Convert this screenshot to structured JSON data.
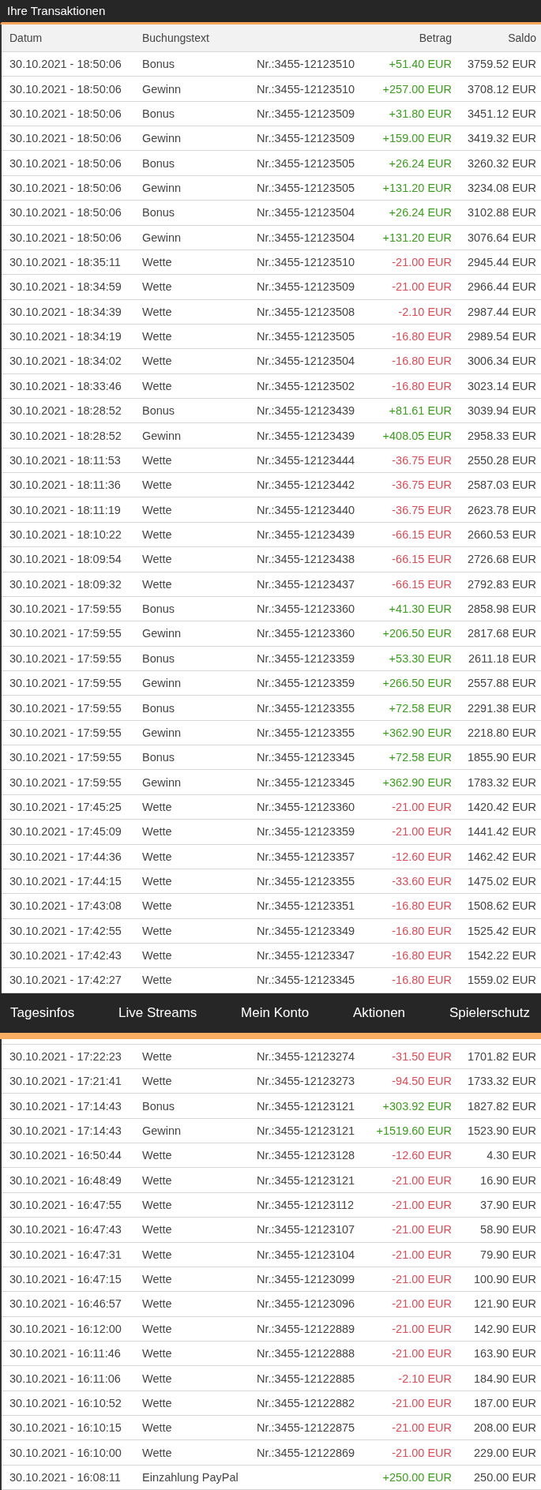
{
  "title": "Ihre Transaktionen",
  "columns": [
    "Datum",
    "Buchungstext",
    "Betrag",
    "Saldo"
  ],
  "transactions": [
    {
      "date": "30.10.2021 - 18:50:06",
      "text": "Bonus",
      "reference": "Nr.:3455-12123510",
      "amount": "+51.40 EUR",
      "balance": "3759.52 EUR",
      "kind": "credit"
    },
    {
      "date": "30.10.2021 - 18:50:06",
      "text": "Gewinn",
      "reference": "Nr.:3455-12123510",
      "amount": "+257.00 EUR",
      "balance": "3708.12 EUR",
      "kind": "credit"
    },
    {
      "date": "30.10.2021 - 18:50:06",
      "text": "Bonus",
      "reference": "Nr.:3455-12123509",
      "amount": "+31.80 EUR",
      "balance": "3451.12 EUR",
      "kind": "credit"
    },
    {
      "date": "30.10.2021 - 18:50:06",
      "text": "Gewinn",
      "reference": "Nr.:3455-12123509",
      "amount": "+159.00 EUR",
      "balance": "3419.32 EUR",
      "kind": "credit"
    },
    {
      "date": "30.10.2021 - 18:50:06",
      "text": "Bonus",
      "reference": "Nr.:3455-12123505",
      "amount": "+26.24 EUR",
      "balance": "3260.32 EUR",
      "kind": "credit"
    },
    {
      "date": "30.10.2021 - 18:50:06",
      "text": "Gewinn",
      "reference": "Nr.:3455-12123505",
      "amount": "+131.20 EUR",
      "balance": "3234.08 EUR",
      "kind": "credit"
    },
    {
      "date": "30.10.2021 - 18:50:06",
      "text": "Bonus",
      "reference": "Nr.:3455-12123504",
      "amount": "+26.24 EUR",
      "balance": "3102.88 EUR",
      "kind": "credit"
    },
    {
      "date": "30.10.2021 - 18:50:06",
      "text": "Gewinn",
      "reference": "Nr.:3455-12123504",
      "amount": "+131.20 EUR",
      "balance": "3076.64 EUR",
      "kind": "credit"
    },
    {
      "date": "30.10.2021 - 18:35:11",
      "text": "Wette",
      "reference": "Nr.:3455-12123510",
      "amount": "-21.00 EUR",
      "balance": "2945.44 EUR",
      "kind": "debit"
    },
    {
      "date": "30.10.2021 - 18:34:59",
      "text": "Wette",
      "reference": "Nr.:3455-12123509",
      "amount": "-21.00 EUR",
      "balance": "2966.44 EUR",
      "kind": "debit"
    },
    {
      "date": "30.10.2021 - 18:34:39",
      "text": "Wette",
      "reference": "Nr.:3455-12123508",
      "amount": "-2.10 EUR",
      "balance": "2987.44 EUR",
      "kind": "debit"
    },
    {
      "date": "30.10.2021 - 18:34:19",
      "text": "Wette",
      "reference": "Nr.:3455-12123505",
      "amount": "-16.80 EUR",
      "balance": "2989.54 EUR",
      "kind": "debit"
    },
    {
      "date": "30.10.2021 - 18:34:02",
      "text": "Wette",
      "reference": "Nr.:3455-12123504",
      "amount": "-16.80 EUR",
      "balance": "3006.34 EUR",
      "kind": "debit"
    },
    {
      "date": "30.10.2021 - 18:33:46",
      "text": "Wette",
      "reference": "Nr.:3455-12123502",
      "amount": "-16.80 EUR",
      "balance": "3023.14 EUR",
      "kind": "debit"
    },
    {
      "date": "30.10.2021 - 18:28:52",
      "text": "Bonus",
      "reference": "Nr.:3455-12123439",
      "amount": "+81.61 EUR",
      "balance": "3039.94 EUR",
      "kind": "credit"
    },
    {
      "date": "30.10.2021 - 18:28:52",
      "text": "Gewinn",
      "reference": "Nr.:3455-12123439",
      "amount": "+408.05 EUR",
      "balance": "2958.33 EUR",
      "kind": "credit"
    },
    {
      "date": "30.10.2021 - 18:11:53",
      "text": "Wette",
      "reference": "Nr.:3455-12123444",
      "amount": "-36.75 EUR",
      "balance": "2550.28 EUR",
      "kind": "debit"
    },
    {
      "date": "30.10.2021 - 18:11:36",
      "text": "Wette",
      "reference": "Nr.:3455-12123442",
      "amount": "-36.75 EUR",
      "balance": "2587.03 EUR",
      "kind": "debit"
    },
    {
      "date": "30.10.2021 - 18:11:19",
      "text": "Wette",
      "reference": "Nr.:3455-12123440",
      "amount": "-36.75 EUR",
      "balance": "2623.78 EUR",
      "kind": "debit"
    },
    {
      "date": "30.10.2021 - 18:10:22",
      "text": "Wette",
      "reference": "Nr.:3455-12123439",
      "amount": "-66.15 EUR",
      "balance": "2660.53 EUR",
      "kind": "debit"
    },
    {
      "date": "30.10.2021 - 18:09:54",
      "text": "Wette",
      "reference": "Nr.:3455-12123438",
      "amount": "-66.15 EUR",
      "balance": "2726.68 EUR",
      "kind": "debit"
    },
    {
      "date": "30.10.2021 - 18:09:32",
      "text": "Wette",
      "reference": "Nr.:3455-12123437",
      "amount": "-66.15 EUR",
      "balance": "2792.83 EUR",
      "kind": "debit"
    },
    {
      "date": "30.10.2021 - 17:59:55",
      "text": "Bonus",
      "reference": "Nr.:3455-12123360",
      "amount": "+41.30 EUR",
      "balance": "2858.98 EUR",
      "kind": "credit"
    },
    {
      "date": "30.10.2021 - 17:59:55",
      "text": "Gewinn",
      "reference": "Nr.:3455-12123360",
      "amount": "+206.50 EUR",
      "balance": "2817.68 EUR",
      "kind": "credit"
    },
    {
      "date": "30.10.2021 - 17:59:55",
      "text": "Bonus",
      "reference": "Nr.:3455-12123359",
      "amount": "+53.30 EUR",
      "balance": "2611.18 EUR",
      "kind": "credit"
    },
    {
      "date": "30.10.2021 - 17:59:55",
      "text": "Gewinn",
      "reference": "Nr.:3455-12123359",
      "amount": "+266.50 EUR",
      "balance": "2557.88 EUR",
      "kind": "credit"
    },
    {
      "date": "30.10.2021 - 17:59:55",
      "text": "Bonus",
      "reference": "Nr.:3455-12123355",
      "amount": "+72.58 EUR",
      "balance": "2291.38 EUR",
      "kind": "credit"
    },
    {
      "date": "30.10.2021 - 17:59:55",
      "text": "Gewinn",
      "reference": "Nr.:3455-12123355",
      "amount": "+362.90 EUR",
      "balance": "2218.80 EUR",
      "kind": "credit"
    },
    {
      "date": "30.10.2021 - 17:59:55",
      "text": "Bonus",
      "reference": "Nr.:3455-12123345",
      "amount": "+72.58 EUR",
      "balance": "1855.90 EUR",
      "kind": "credit"
    },
    {
      "date": "30.10.2021 - 17:59:55",
      "text": "Gewinn",
      "reference": "Nr.:3455-12123345",
      "amount": "+362.90 EUR",
      "balance": "1783.32 EUR",
      "kind": "credit"
    },
    {
      "date": "30.10.2021 - 17:45:25",
      "text": "Wette",
      "reference": "Nr.:3455-12123360",
      "amount": "-21.00 EUR",
      "balance": "1420.42 EUR",
      "kind": "debit"
    },
    {
      "date": "30.10.2021 - 17:45:09",
      "text": "Wette",
      "reference": "Nr.:3455-12123359",
      "amount": "-21.00 EUR",
      "balance": "1441.42 EUR",
      "kind": "debit"
    },
    {
      "date": "30.10.2021 - 17:44:36",
      "text": "Wette",
      "reference": "Nr.:3455-12123357",
      "amount": "-12.60 EUR",
      "balance": "1462.42 EUR",
      "kind": "debit"
    },
    {
      "date": "30.10.2021 - 17:44:15",
      "text": "Wette",
      "reference": "Nr.:3455-12123355",
      "amount": "-33.60 EUR",
      "balance": "1475.02 EUR",
      "kind": "debit"
    },
    {
      "date": "30.10.2021 - 17:43:08",
      "text": "Wette",
      "reference": "Nr.:3455-12123351",
      "amount": "-16.80 EUR",
      "balance": "1508.62 EUR",
      "kind": "debit"
    },
    {
      "date": "30.10.2021 - 17:42:55",
      "text": "Wette",
      "reference": "Nr.:3455-12123349",
      "amount": "-16.80 EUR",
      "balance": "1525.42 EUR",
      "kind": "debit"
    },
    {
      "date": "30.10.2021 - 17:42:43",
      "text": "Wette",
      "reference": "Nr.:3455-12123347",
      "amount": "-16.80 EUR",
      "balance": "1542.22 EUR",
      "kind": "debit"
    },
    {
      "date": "30.10.2021 - 17:42:27",
      "text": "Wette",
      "reference": "Nr.:3455-12123345",
      "amount": "-16.80 EUR",
      "balance": "1559.02 EUR",
      "kind": "debit"
    }
  ],
  "nav": {
    "items": [
      "Tagesinfos",
      "Live Streams",
      "Mein Konto",
      "Aktionen",
      "Spielerschutz"
    ]
  },
  "transactions_continued": [
    {
      "date": "30.10.2021 - 17:22:23",
      "text": "Wette",
      "reference": "Nr.:3455-12123274",
      "amount": "-31.50 EUR",
      "balance": "1701.82 EUR",
      "kind": "debit"
    },
    {
      "date": "30.10.2021 - 17:21:41",
      "text": "Wette",
      "reference": "Nr.:3455-12123273",
      "amount": "-94.50 EUR",
      "balance": "1733.32 EUR",
      "kind": "debit"
    },
    {
      "date": "30.10.2021 - 17:14:43",
      "text": "Bonus",
      "reference": "Nr.:3455-12123121",
      "amount": "+303.92 EUR",
      "balance": "1827.82 EUR",
      "kind": "credit"
    },
    {
      "date": "30.10.2021 - 17:14:43",
      "text": "Gewinn",
      "reference": "Nr.:3455-12123121",
      "amount": "+1519.60 EUR",
      "balance": "1523.90 EUR",
      "kind": "credit"
    },
    {
      "date": "30.10.2021 - 16:50:44",
      "text": "Wette",
      "reference": "Nr.:3455-12123128",
      "amount": "-12.60 EUR",
      "balance": "4.30 EUR",
      "kind": "debit"
    },
    {
      "date": "30.10.2021 - 16:48:49",
      "text": "Wette",
      "reference": "Nr.:3455-12123121",
      "amount": "-21.00 EUR",
      "balance": "16.90 EUR",
      "kind": "debit"
    },
    {
      "date": "30.10.2021 - 16:47:55",
      "text": "Wette",
      "reference": "Nr.:3455-12123112",
      "amount": "-21.00 EUR",
      "balance": "37.90 EUR",
      "kind": "debit"
    },
    {
      "date": "30.10.2021 - 16:47:43",
      "text": "Wette",
      "reference": "Nr.:3455-12123107",
      "amount": "-21.00 EUR",
      "balance": "58.90 EUR",
      "kind": "debit"
    },
    {
      "date": "30.10.2021 - 16:47:31",
      "text": "Wette",
      "reference": "Nr.:3455-12123104",
      "amount": "-21.00 EUR",
      "balance": "79.90 EUR",
      "kind": "debit"
    },
    {
      "date": "30.10.2021 - 16:47:15",
      "text": "Wette",
      "reference": "Nr.:3455-12123099",
      "amount": "-21.00 EUR",
      "balance": "100.90 EUR",
      "kind": "debit"
    },
    {
      "date": "30.10.2021 - 16:46:57",
      "text": "Wette",
      "reference": "Nr.:3455-12123096",
      "amount": "-21.00 EUR",
      "balance": "121.90 EUR",
      "kind": "debit"
    },
    {
      "date": "30.10.2021 - 16:12:00",
      "text": "Wette",
      "reference": "Nr.:3455-12122889",
      "amount": "-21.00 EUR",
      "balance": "142.90 EUR",
      "kind": "debit"
    },
    {
      "date": "30.10.2021 - 16:11:46",
      "text": "Wette",
      "reference": "Nr.:3455-12122888",
      "amount": "-21.00 EUR",
      "balance": "163.90 EUR",
      "kind": "debit"
    },
    {
      "date": "30.10.2021 - 16:11:06",
      "text": "Wette",
      "reference": "Nr.:3455-12122885",
      "amount": "-2.10 EUR",
      "balance": "184.90 EUR",
      "kind": "debit"
    },
    {
      "date": "30.10.2021 - 16:10:52",
      "text": "Wette",
      "reference": "Nr.:3455-12122882",
      "amount": "-21.00 EUR",
      "balance": "187.00 EUR",
      "kind": "debit"
    },
    {
      "date": "30.10.2021 - 16:10:15",
      "text": "Wette",
      "reference": "Nr.:3455-12122875",
      "amount": "-21.00 EUR",
      "balance": "208.00 EUR",
      "kind": "debit"
    },
    {
      "date": "30.10.2021 - 16:10:00",
      "text": "Wette",
      "reference": "Nr.:3455-12122869",
      "amount": "-21.00 EUR",
      "balance": "229.00 EUR",
      "kind": "debit"
    },
    {
      "date": "30.10.2021 - 16:08:11",
      "text": "Einzahlung PayPal",
      "amount": "+250.00 EUR",
      "balance": "250.00 EUR",
      "kind": "credit"
    }
  ]
}
